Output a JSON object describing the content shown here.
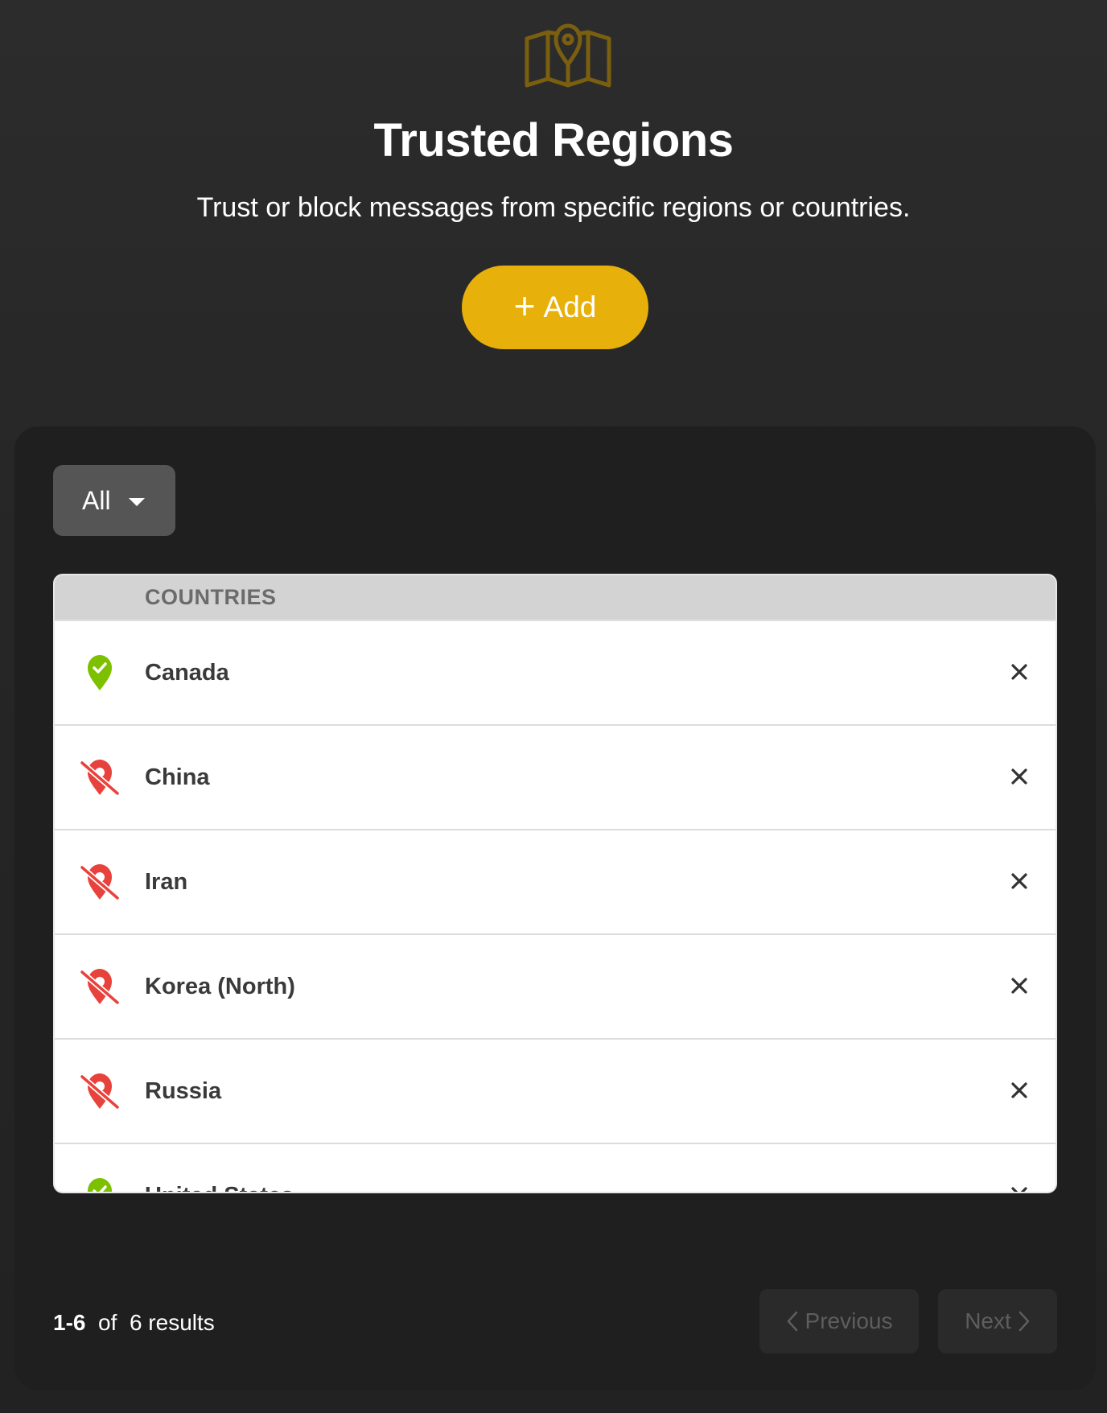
{
  "header": {
    "icon": "map-pin-icon",
    "title": "Trusted Regions",
    "subtitle": "Trust or block messages from specific regions or countries.",
    "add_button": {
      "plus": "+",
      "label": "Add"
    },
    "accent_color": "#e8b00a",
    "icon_color": "#7a5f10"
  },
  "filter": {
    "selected": "All"
  },
  "table": {
    "column_header": "COUNTRIES",
    "rows": [
      {
        "name": "Canada",
        "status": "trusted"
      },
      {
        "name": "China",
        "status": "blocked"
      },
      {
        "name": "Iran",
        "status": "blocked"
      },
      {
        "name": "Korea (North)",
        "status": "blocked"
      },
      {
        "name": "Russia",
        "status": "blocked"
      },
      {
        "name": "United States",
        "status": "trusted"
      }
    ],
    "trusted_color": "#7cc000",
    "blocked_color": "#e8423c"
  },
  "footer": {
    "range": "1-6",
    "of": "of",
    "total": "6 results",
    "previous_label": "Previous",
    "next_label": "Next"
  }
}
